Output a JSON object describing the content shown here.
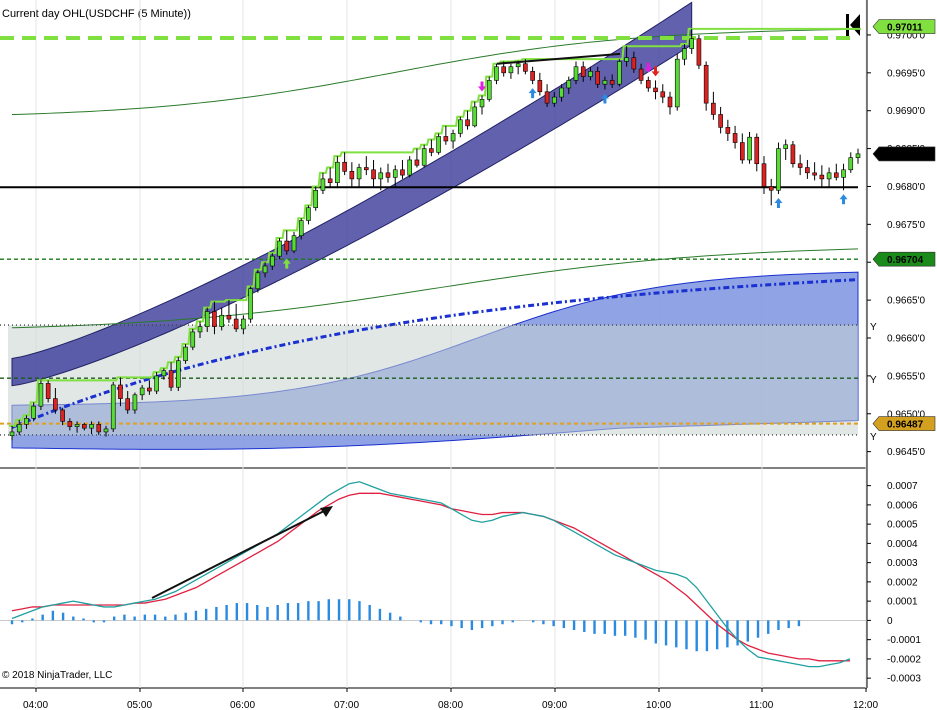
{
  "chart_data": [
    {
      "type": "candlestick",
      "title": "Current day OHL(USDCHF (5 Minute))",
      "x_ticks": [
        "04:00",
        "05:00",
        "06:00",
        "07:00",
        "08:00",
        "09:00",
        "10:00",
        "11:00",
        "12:00"
      ],
      "y_ticks": [
        "0.9700'0",
        "0.9695'0",
        "0.9690'0",
        "0.9685'0",
        "0.9680'0",
        "0.9675'0",
        "0.9670'0",
        "0.9665'0",
        "0.9660'0",
        "0.9655'0",
        "0.9650'0",
        "0.9645'0"
      ],
      "ylim": [
        0.96435,
        0.97025
      ],
      "price_flags": [
        {
          "label": "0.97011",
          "value": 0.97011,
          "color": "#80e040"
        },
        {
          "label": "0.9684'3",
          "value": 0.96843,
          "color": "#000000"
        },
        {
          "label": "0.96704",
          "value": 0.96704,
          "color": "#1a8a1a"
        },
        {
          "label": "0.96487",
          "value": 0.96487,
          "color": "#d4a020"
        }
      ],
      "horizontal_lines": [
        {
          "value": 0.96996,
          "style": "dashed",
          "color": "#80e040"
        },
        {
          "value": 0.96799,
          "style": "solid",
          "color": "#000000"
        },
        {
          "value": 0.96704,
          "style": "dashed",
          "color": "#1a7a1a"
        },
        {
          "value": 0.96617,
          "style": "dotted",
          "color": "#444444"
        },
        {
          "value": 0.96547,
          "style": "dashed",
          "color": "#1a5a1a"
        },
        {
          "value": 0.96487,
          "style": "dashed",
          "color": "#e0a020"
        },
        {
          "value": 0.96472,
          "style": "dotted",
          "color": "#444444"
        }
      ],
      "y_markers": [
        "Y",
        "Y",
        "Y"
      ],
      "candles": [
        [
          0.96471,
          0.96484,
          0.96465,
          0.96476
        ],
        [
          0.96476,
          0.96492,
          0.96472,
          0.96486
        ],
        [
          0.96486,
          0.96498,
          0.9648,
          0.96494
        ],
        [
          0.96494,
          0.96515,
          0.9649,
          0.9651
        ],
        [
          0.9651,
          0.96544,
          0.96505,
          0.9654
        ],
        [
          0.9654,
          0.96544,
          0.96515,
          0.9652
        ],
        [
          0.9652,
          0.96534,
          0.965,
          0.96505
        ],
        [
          0.96505,
          0.96508,
          0.96485,
          0.9649
        ],
        [
          0.9649,
          0.96494,
          0.96478,
          0.96483
        ],
        [
          0.96483,
          0.9649,
          0.96475,
          0.96486
        ],
        [
          0.96486,
          0.96488,
          0.96478,
          0.96481
        ],
        [
          0.96481,
          0.9649,
          0.96473,
          0.96486
        ],
        [
          0.96486,
          0.9649,
          0.96472,
          0.96476
        ],
        [
          0.96476,
          0.96484,
          0.9647,
          0.9648
        ],
        [
          0.9648,
          0.96542,
          0.96476,
          0.96538
        ],
        [
          0.96538,
          0.96548,
          0.9651,
          0.9652
        ],
        [
          0.9652,
          0.9653,
          0.965,
          0.96505
        ],
        [
          0.96505,
          0.96528,
          0.965,
          0.96525
        ],
        [
          0.96525,
          0.96538,
          0.96518,
          0.96534
        ],
        [
          0.96534,
          0.96544,
          0.96525,
          0.9653
        ],
        [
          0.9653,
          0.96555,
          0.96526,
          0.9655
        ],
        [
          0.9655,
          0.9656,
          0.96545,
          0.96557
        ],
        [
          0.96557,
          0.96568,
          0.9653,
          0.96535
        ],
        [
          0.96535,
          0.96575,
          0.9653,
          0.9657
        ],
        [
          0.9657,
          0.96592,
          0.96566,
          0.96588
        ],
        [
          0.96588,
          0.96612,
          0.96584,
          0.96608
        ],
        [
          0.96608,
          0.96622,
          0.966,
          0.96615
        ],
        [
          0.96615,
          0.9664,
          0.96608,
          0.96635
        ],
        [
          0.96635,
          0.96648,
          0.96605,
          0.96615
        ],
        [
          0.96615,
          0.9664,
          0.9661,
          0.9663
        ],
        [
          0.9663,
          0.9665,
          0.9662,
          0.96625
        ],
        [
          0.96625,
          0.96645,
          0.96608,
          0.96612
        ],
        [
          0.96612,
          0.9663,
          0.96605,
          0.96625
        ],
        [
          0.96625,
          0.96668,
          0.9662,
          0.96665
        ],
        [
          0.96665,
          0.9669,
          0.9666,
          0.96686
        ],
        [
          0.96686,
          0.967,
          0.9668,
          0.96695
        ],
        [
          0.96695,
          0.96712,
          0.9669,
          0.96708
        ],
        [
          0.96708,
          0.96732,
          0.96704,
          0.96728
        ],
        [
          0.96728,
          0.96742,
          0.9671,
          0.96715
        ],
        [
          0.96715,
          0.9674,
          0.96712,
          0.96735
        ],
        [
          0.96735,
          0.96758,
          0.9673,
          0.96755
        ],
        [
          0.96755,
          0.96775,
          0.9675,
          0.96772
        ],
        [
          0.96772,
          0.968,
          0.96768,
          0.96795
        ],
        [
          0.96795,
          0.96818,
          0.9679,
          0.9681
        ],
        [
          0.9681,
          0.96825,
          0.96798,
          0.96805
        ],
        [
          0.96805,
          0.9684,
          0.968,
          0.96832
        ],
        [
          0.96832,
          0.96845,
          0.96815,
          0.9682
        ],
        [
          0.9682,
          0.96832,
          0.968,
          0.9681
        ],
        [
          0.9681,
          0.9683,
          0.96798,
          0.96825
        ],
        [
          0.96825,
          0.9684,
          0.96815,
          0.96822
        ],
        [
          0.96822,
          0.96835,
          0.968,
          0.9681
        ],
        [
          0.9681,
          0.96825,
          0.96795,
          0.96818
        ],
        [
          0.96818,
          0.9683,
          0.96805,
          0.96812
        ],
        [
          0.96812,
          0.96828,
          0.968,
          0.96822
        ],
        [
          0.96822,
          0.96835,
          0.9681,
          0.96815
        ],
        [
          0.96815,
          0.9684,
          0.96812,
          0.96835
        ],
        [
          0.96835,
          0.9685,
          0.96825,
          0.96828
        ],
        [
          0.96828,
          0.96855,
          0.96825,
          0.9685
        ],
        [
          0.9685,
          0.96862,
          0.9684,
          0.96845
        ],
        [
          0.96845,
          0.9687,
          0.96842,
          0.96866
        ],
        [
          0.96866,
          0.9688,
          0.96855,
          0.9686
        ],
        [
          0.9686,
          0.96875,
          0.9685,
          0.9687
        ],
        [
          0.9687,
          0.96892,
          0.96865,
          0.96888
        ],
        [
          0.96888,
          0.969,
          0.96875,
          0.9688
        ],
        [
          0.9688,
          0.96912,
          0.96878,
          0.96905
        ],
        [
          0.96905,
          0.9692,
          0.96895,
          0.96915
        ],
        [
          0.96915,
          0.96945,
          0.96912,
          0.9694
        ],
        [
          0.9694,
          0.96962,
          0.96935,
          0.96958
        ],
        [
          0.96958,
          0.96965,
          0.96945,
          0.9695
        ],
        [
          0.9695,
          0.96962,
          0.96942,
          0.96958
        ],
        [
          0.96958,
          0.96966,
          0.96948,
          0.96962
        ],
        [
          0.96962,
          0.96968,
          0.96948,
          0.96952
        ],
        [
          0.96952,
          0.96958,
          0.96935,
          0.9694
        ],
        [
          0.9694,
          0.9695,
          0.9692,
          0.96925
        ],
        [
          0.96925,
          0.96935,
          0.96905,
          0.9691
        ],
        [
          0.9691,
          0.96925,
          0.96905,
          0.96918
        ],
        [
          0.96918,
          0.96935,
          0.96912,
          0.9693
        ],
        [
          0.9693,
          0.96945,
          0.96922,
          0.9694
        ],
        [
          0.9694,
          0.96965,
          0.96935,
          0.96958
        ],
        [
          0.96958,
          0.96965,
          0.96938,
          0.96945
        ],
        [
          0.96945,
          0.96958,
          0.9694,
          0.96952
        ],
        [
          0.96952,
          0.96958,
          0.9693,
          0.96935
        ],
        [
          0.96935,
          0.96945,
          0.96928,
          0.9694
        ],
        [
          0.9694,
          0.96948,
          0.9693,
          0.96935
        ],
        [
          0.96935,
          0.96968,
          0.96932,
          0.96965
        ],
        [
          0.96965,
          0.96985,
          0.96958,
          0.9697
        ],
        [
          0.9697,
          0.96978,
          0.9695,
          0.96955
        ],
        [
          0.96955,
          0.96962,
          0.96935,
          0.9694
        ],
        [
          0.9694,
          0.96945,
          0.96925,
          0.9693
        ],
        [
          0.9693,
          0.9694,
          0.96915,
          0.96925
        ],
        [
          0.96925,
          0.96935,
          0.9691,
          0.96918
        ],
        [
          0.96918,
          0.96925,
          0.96895,
          0.96905
        ],
        [
          0.96905,
          0.96975,
          0.969,
          0.96968
        ],
        [
          0.96968,
          0.96988,
          0.9696,
          0.96982
        ],
        [
          0.96982,
          0.97008,
          0.96975,
          0.96995
        ],
        [
          0.96995,
          0.97,
          0.96955,
          0.9696
        ],
        [
          0.9696,
          0.96965,
          0.969,
          0.9691
        ],
        [
          0.9691,
          0.96925,
          0.96888,
          0.96895
        ],
        [
          0.96895,
          0.96905,
          0.9687,
          0.96878
        ],
        [
          0.96878,
          0.96888,
          0.9686,
          0.9687
        ],
        [
          0.9687,
          0.9688,
          0.9685,
          0.96858
        ],
        [
          0.96858,
          0.9687,
          0.9683,
          0.96835
        ],
        [
          0.96835,
          0.96872,
          0.9683,
          0.96865
        ],
        [
          0.96865,
          0.9687,
          0.9682,
          0.9683
        ],
        [
          0.9683,
          0.9684,
          0.9679,
          0.968
        ],
        [
          0.968,
          0.9681,
          0.96775,
          0.96795
        ],
        [
          0.96795,
          0.96858,
          0.9679,
          0.9685
        ],
        [
          0.9685,
          0.96862,
          0.96835,
          0.96855
        ],
        [
          0.96855,
          0.9686,
          0.96825,
          0.9683
        ],
        [
          0.9683,
          0.96842,
          0.96815,
          0.96825
        ],
        [
          0.96825,
          0.96835,
          0.9681,
          0.96818
        ],
        [
          0.96818,
          0.96832,
          0.96808,
          0.96815
        ],
        [
          0.96815,
          0.96828,
          0.968,
          0.9681
        ],
        [
          0.9681,
          0.96825,
          0.96798,
          0.96818
        ],
        [
          0.96818,
          0.9683,
          0.96808,
          0.96812
        ],
        [
          0.96812,
          0.9683,
          0.96795,
          0.96822
        ],
        [
          0.96822,
          0.96845,
          0.96818,
          0.96838
        ],
        [
          0.96838,
          0.9685,
          0.9683,
          0.96843
        ]
      ]
    },
    {
      "type": "macd",
      "y_ticks": [
        "0.0007",
        "0.0006",
        "0.0005",
        "0.0004",
        "0.0003",
        "0.0002",
        "0.0001",
        "0",
        "-0.0001",
        "-0.0002",
        "-0.0003"
      ],
      "ylim": [
        -0.00032,
        0.00075
      ],
      "macd": [
        1e-05,
        3e-05,
        5e-05,
        7e-05,
        8e-05,
        9e-05,
        0.0001,
        9e-05,
        8e-05,
        7e-05,
        7e-05,
        8e-05,
        9e-05,
        0.0001,
        0.00011,
        0.00013,
        0.00015,
        0.00018,
        0.00021,
        0.00024,
        0.00027,
        0.0003,
        0.00033,
        0.00036,
        0.00039,
        0.00042,
        0.00045,
        0.00049,
        0.00053,
        0.00057,
        0.00061,
        0.00065,
        0.00068,
        0.00071,
        0.00072,
        0.0007,
        0.00068,
        0.00066,
        0.00065,
        0.00064,
        0.00063,
        0.00062,
        0.00061,
        0.00058,
        0.00055,
        0.00052,
        0.00051,
        0.00052,
        0.00054,
        0.00055,
        0.00056,
        0.00055,
        0.00054,
        0.00052,
        0.00049,
        0.00046,
        0.00043,
        0.0004,
        0.00037,
        0.00034,
        0.00032,
        0.0003,
        0.00028,
        0.00026,
        0.00025,
        0.00024,
        0.00022,
        0.00017,
        0.0001,
        3e-05,
        -4e-05,
        -0.0001,
        -0.00015,
        -0.00019,
        -0.0002,
        -0.00021,
        -0.00022,
        -0.00023,
        -0.00024,
        -0.00024,
        -0.00023,
        -0.00022,
        -0.0002
      ],
      "signal": [
        5e-05,
        6e-05,
        7e-05,
        7e-05,
        8e-05,
        8e-05,
        8e-05,
        8e-05,
        8e-05,
        8e-05,
        8e-05,
        8e-05,
        9e-05,
        9e-05,
        0.0001,
        0.00011,
        0.00013,
        0.00015,
        0.00017,
        0.0002,
        0.00023,
        0.00026,
        0.00029,
        0.00032,
        0.00035,
        0.00038,
        0.00041,
        0.00045,
        0.00049,
        0.00053,
        0.00057,
        0.0006,
        0.00063,
        0.00065,
        0.00066,
        0.00066,
        0.00066,
        0.00065,
        0.00064,
        0.00063,
        0.00062,
        0.00061,
        0.0006,
        0.00058,
        0.00057,
        0.00056,
        0.00055,
        0.00055,
        0.00056,
        0.00056,
        0.00056,
        0.00055,
        0.00054,
        0.00052,
        0.0005,
        0.00048,
        0.00045,
        0.00042,
        0.00039,
        0.00036,
        0.00033,
        0.0003,
        0.00027,
        0.00024,
        0.00021,
        0.00017,
        0.00013,
        8e-05,
        3e-05,
        -2e-05,
        -6e-05,
        -0.0001,
        -0.00013,
        -0.00015,
        -0.00017,
        -0.00018,
        -0.00019,
        -0.0002,
        -0.0002,
        -0.00021,
        -0.00021,
        -0.00021,
        -0.00021
      ],
      "histogram": [
        -2e-05,
        -1e-05,
        1e-05,
        3e-05,
        5e-05,
        4e-05,
        2e-05,
        1e-05,
        -1e-05,
        -1e-05,
        2e-05,
        3e-05,
        2e-05,
        3e-05,
        3e-05,
        2e-05,
        3e-05,
        4e-05,
        5e-05,
        6e-05,
        7e-05,
        8e-05,
        9e-05,
        9e-05,
        8e-05,
        7e-05,
        8e-05,
        9e-05,
        9e-05,
        0.0001,
        0.0001,
        0.00011,
        0.00011,
        0.00011,
        0.0001,
        8e-05,
        6e-05,
        4e-05,
        2e-05,
        0.0,
        -1e-05,
        -2e-05,
        -2e-05,
        -3e-05,
        -4e-05,
        -5e-05,
        -4e-05,
        -3e-05,
        -2e-05,
        -1e-05,
        0.0,
        -1e-05,
        -2e-05,
        -3e-05,
        -4e-05,
        -5e-05,
        -6e-05,
        -7e-05,
        -7e-05,
        -8e-05,
        -8e-05,
        -9e-05,
        -0.0001,
        -0.00012,
        -0.00013,
        -0.00014,
        -0.00015,
        -0.00016,
        -0.00016,
        -0.00015,
        -0.00014,
        -0.00013,
        -0.00011,
        -9e-05,
        -7e-05,
        -5e-05,
        -4e-05,
        -3e-05
      ]
    }
  ],
  "copyright": "© 2018 NinjaTrader, LLC",
  "colors": {
    "up": "#55dd33",
    "down": "#dd2222",
    "macd_line": "#20a0a0",
    "signal_line": "#e02040",
    "histogram": "#2a8ae0",
    "channel_dark": "#3a3a9a",
    "channel_light": "#7b93e0",
    "ma_blue": "#1a30d0",
    "ohl_step": "#80e040"
  }
}
